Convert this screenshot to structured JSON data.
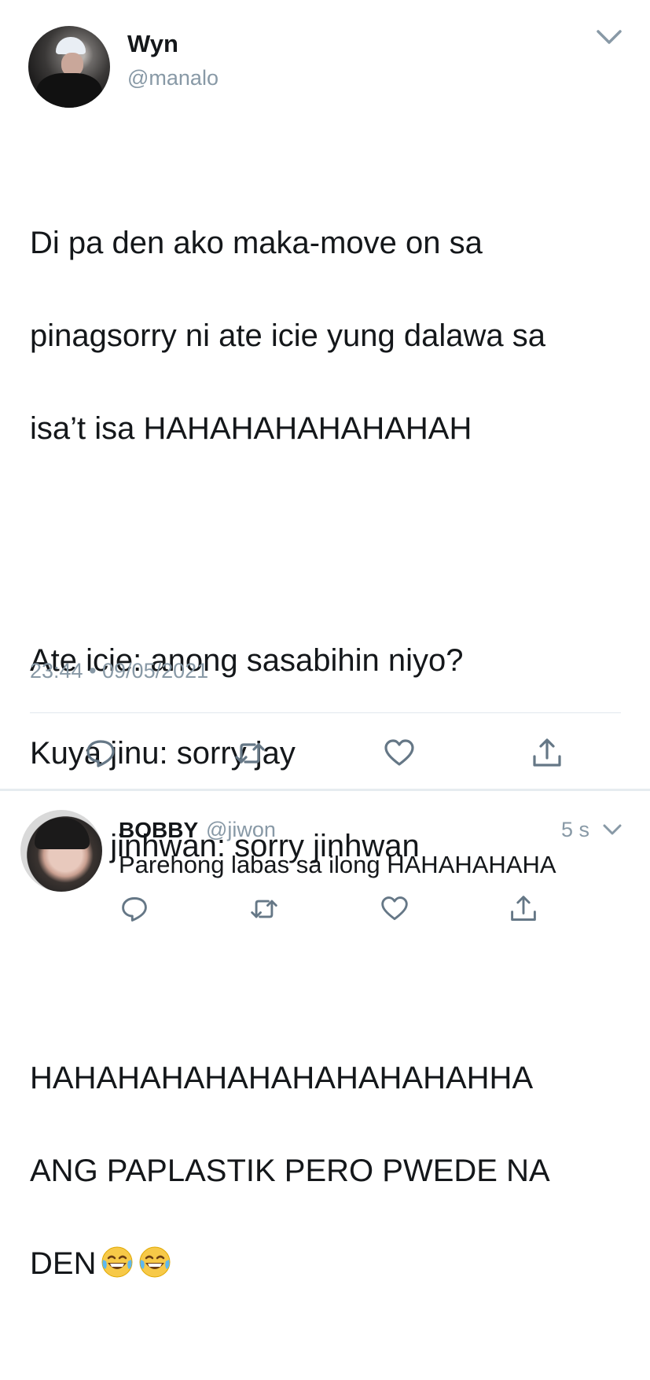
{
  "tweet": {
    "display_name": "Wyn",
    "handle": "@manalo",
    "lines": {
      "p1": [
        "Di pa den ako maka-move on sa",
        "pinagsorry ni ate icie yung dalawa sa",
        "isa’t isa HAHAHAHAHAHAHAH"
      ],
      "p2": [
        "Ate icie: anong sasabihin niyo?",
        "Kuya jinu: sorry jay",
        "Kuya jinhwan: sorry jinhwan"
      ],
      "p3": [
        "HAHAHAHAHAHAHAHAHAHAHHA",
        "ANG PAPLASTIK PERO PWEDE NA",
        "DEN"
      ]
    },
    "emoji": [
      "face-with-tears-of-joy",
      "face-with-tears-of-joy"
    ],
    "timestamp": "23:44 • 09/05/2021",
    "actions": [
      "reply-icon",
      "retweet-icon",
      "like-icon",
      "share-icon"
    ],
    "icon_color": "#657786"
  },
  "reply": {
    "display_name": "BOBBY",
    "handle": "@jiwon",
    "time": "5 s",
    "text": "Parehong labas sa ilong HAHAHAHAHA",
    "actions": [
      "reply-icon",
      "retweet-icon",
      "like-icon",
      "share-icon"
    ]
  }
}
